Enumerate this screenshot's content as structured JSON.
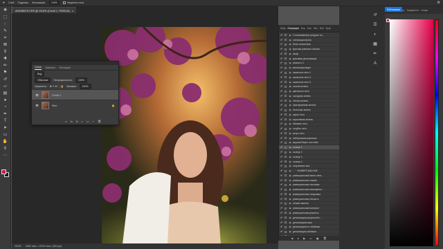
{
  "topbar": {
    "items": [
      "Слой",
      "Подрезка",
      "Экспозиция:",
      "100%",
      "Защитить тона"
    ],
    "exposure_value": "100%"
  },
  "document": {
    "tab_title": "AV9A8575.CR3 @ 28,8% (Слой 1, RGB/16)",
    "close_glyph": "×",
    "zoom": "28,8%",
    "info": "6480 пикс. x 8700 пикс. (300 ppi)"
  },
  "layers_panel": {
    "tabs": [
      "Слои",
      "Каналы",
      "Контуры"
    ],
    "active_tab": "Слои",
    "kind_filter": "Вид",
    "blend_mode": "Обычные",
    "opacity_label": "Непрозрачность:",
    "opacity_value": "100%",
    "lock_label": "Закрепить:",
    "fill_label": "Заливка:",
    "fill_value": "100%",
    "layers": [
      {
        "name": "Слой 1",
        "selected": true
      },
      {
        "name": "Фон",
        "selected": false
      }
    ]
  },
  "actions_panel": {
    "tabs": [
      "Инф",
      "Операции",
      "Кор",
      "Сво",
      "Кис",
      "Исп",
      "Буф"
    ],
    "active_tab": "Операции",
    "items": [
      {
        "label": "Стилизованные ресурсы по...",
        "state": "action"
      },
      {
        "label": "стилизация фона",
        "state": "action"
      },
      {
        "label": "Блюз на волосах",
        "state": "action"
      },
      {
        "label": "красная рамочка и брова",
        "state": "action"
      },
      {
        "label": "загар",
        "state": "action"
      },
      {
        "label": "красивая детализация",
        "state": "action"
      },
      {
        "label": "резкость 1",
        "state": "action"
      },
      {
        "label": "миниатюризация",
        "state": "action"
      },
      {
        "label": "сказочное лето 1",
        "state": "action"
      },
      {
        "label": "сказочное лето 2",
        "state": "action"
      },
      {
        "label": "сказочное лето 3",
        "state": "action"
      },
      {
        "label": "сочная зелень",
        "state": "action"
      },
      {
        "label": "цветочное лето",
        "state": "action"
      },
      {
        "label": "холодная зелень",
        "state": "action"
      },
      {
        "label": "тёплая зелень",
        "state": "action"
      },
      {
        "label": "приглушенная зелень",
        "state": "action"
      },
      {
        "label": "болотная зелень",
        "state": "action"
      },
      {
        "label": "серое лето",
        "state": "action"
      },
      {
        "label": "коричневая зелень",
        "state": "action"
      },
      {
        "label": "бежевое лето",
        "state": "action"
      },
      {
        "label": "голубое лето",
        "state": "action"
      },
      {
        "label": "ретро лето",
        "state": "action"
      },
      {
        "label": "нейтральная картинка",
        "state": "action"
      },
      {
        "label": "морской берег или небо",
        "state": "action"
      },
      {
        "label": "солнце 1",
        "state": "selected"
      },
      {
        "label": "солнце 2",
        "state": "action"
      },
      {
        "label": "солнце 3",
        "state": "action"
      },
      {
        "label": "солнце 4",
        "state": "action"
      },
      {
        "label": "сохранение мес",
        "state": "action"
      },
      {
        "label": "УНИВЕРСАЛЬНЫЕ",
        "state": "folder"
      },
      {
        "label": "универсальный свето-тени...",
        "state": "action"
      },
      {
        "label": "универсальное сияние",
        "state": "action"
      },
      {
        "label": "универсальная тепловая",
        "state": "action"
      },
      {
        "label": "универсальная насыщенно...",
        "state": "action"
      },
      {
        "label": "универсальная тонировка",
        "state": "action"
      },
      {
        "label": "универсальная чёткость",
        "state": "action"
      },
      {
        "label": "чёткий свинтек",
        "state": "action"
      },
      {
        "label": "универсальный контраст",
        "state": "action"
      },
      {
        "label": "универсальная резкость",
        "state": "action"
      },
      {
        "label": "детализация рисунка без...",
        "state": "action"
      },
      {
        "label": "детализация кожи",
        "state": "action"
      },
      {
        "label": "детализация по объёмам",
        "state": "action"
      },
      {
        "label": "детализация объёмов",
        "state": "action"
      },
      {
        "label": "устранение шума",
        "state": "action"
      }
    ]
  },
  "color_panel": {
    "tabs": [
      "Цвет",
      "Образцы",
      "Градиенты",
      "Узоры"
    ],
    "active_tab": "Цвет",
    "foreground": "#c2185b"
  },
  "publish_button": "Публикация",
  "glyphs": {
    "eye": "👁",
    "check": "✔",
    "expand": "▶",
    "folder": "🗀",
    "gear": "⚙",
    "link": "∞",
    "fx": "fx",
    "mask": "◘",
    "adjustment": "◐",
    "group": "▭",
    "new_layer": "+",
    "trash": "🗑",
    "stop": "■",
    "record": "●",
    "play": "▶",
    "new": "▣"
  },
  "colors": {
    "accent": "#1473e6",
    "foreground_swatch": "#c2185b",
    "panel": "#3a3a3a",
    "canvas_bg": "#282828"
  }
}
